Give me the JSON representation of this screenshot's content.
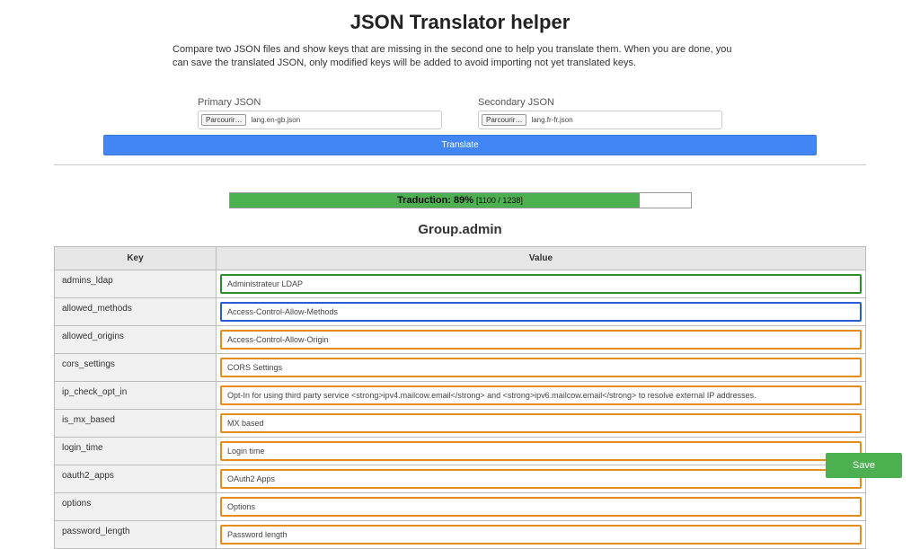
{
  "header": {
    "title": "JSON Translator helper",
    "description": "Compare two JSON files and show keys that are missing in the second one to help you translate them. When you are done, you can save the translated JSON, only modified keys will be added to avoid importing not yet translated keys."
  },
  "files": {
    "primary": {
      "label": "Primary JSON",
      "browse": "Parcourir…",
      "filename": "lang.en-gb.json"
    },
    "secondary": {
      "label": "Secondary JSON",
      "browse": "Parcourir…",
      "filename": "lang.fr-fr.json"
    }
  },
  "actions": {
    "translate": "Translate",
    "save": "Save"
  },
  "progress": {
    "label": "Traduction:",
    "percent": "89%",
    "counts": "[1100 / 1238]",
    "fill_width": "89%"
  },
  "group": {
    "title": "Group.admin",
    "columns": {
      "key": "Key",
      "value": "Value"
    },
    "rows": [
      {
        "key": "admins_ldap",
        "value": "Administrateur LDAP",
        "state": "translated"
      },
      {
        "key": "allowed_methods",
        "value": "Access-Control-Allow-Methods",
        "state": "active"
      },
      {
        "key": "allowed_origins",
        "value": "Access-Control-Allow-Origin",
        "state": "untranslated"
      },
      {
        "key": "cors_settings",
        "value": "CORS Settings",
        "state": "untranslated"
      },
      {
        "key": "ip_check_opt_in",
        "value": "Opt-In for using third party service <strong>ipv4.mailcow.email</strong> and <strong>ipv6.mailcow.email</strong> to resolve external IP addresses.",
        "state": "untranslated"
      },
      {
        "key": "is_mx_based",
        "value": "MX based",
        "state": "untranslated"
      },
      {
        "key": "login_time",
        "value": "Login time",
        "state": "untranslated"
      },
      {
        "key": "oauth2_apps",
        "value": "OAuth2 Apps",
        "state": "untranslated"
      },
      {
        "key": "options",
        "value": "Options",
        "state": "untranslated"
      },
      {
        "key": "password_length",
        "value": "Password length",
        "state": "untranslated"
      }
    ]
  }
}
